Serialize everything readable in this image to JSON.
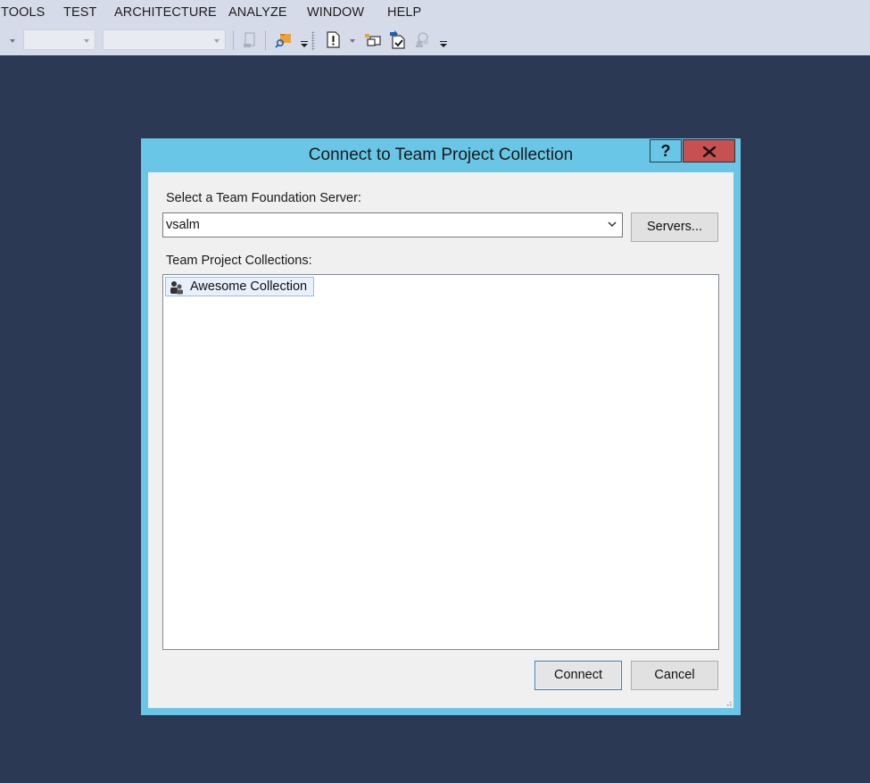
{
  "menu": {
    "items": [
      "TOOLS",
      "TEST",
      "ARCHITECTURE",
      "ANALYZE",
      "WINDOW",
      "HELP"
    ]
  },
  "toolbar": {
    "combo1_value": "",
    "combo2_value": "",
    "icons": [
      "dropdown-arrow-icon",
      "new-item-icon",
      "folder-search-icon",
      "overflow-icon",
      "new-bug-icon",
      "attach-icon",
      "check-in-icon",
      "team-explorer-icon",
      "overflow-icon"
    ]
  },
  "dialog": {
    "title": "Connect to Team Project Collection",
    "help_label": "?",
    "close_label": "X",
    "server_label": "Select a Team Foundation Server:",
    "server_value": "vsalm",
    "servers_button": "Servers...",
    "collections_label": "Team Project Collections:",
    "collections": [
      "Awesome Collection"
    ],
    "connect_button": "Connect",
    "cancel_button": "Cancel"
  },
  "colors": {
    "background": "#2b3954",
    "chrome": "#d6dbe9",
    "dialog_border": "#6ac6e6",
    "close_button": "#c75050",
    "selection": "#e7f0fb"
  }
}
